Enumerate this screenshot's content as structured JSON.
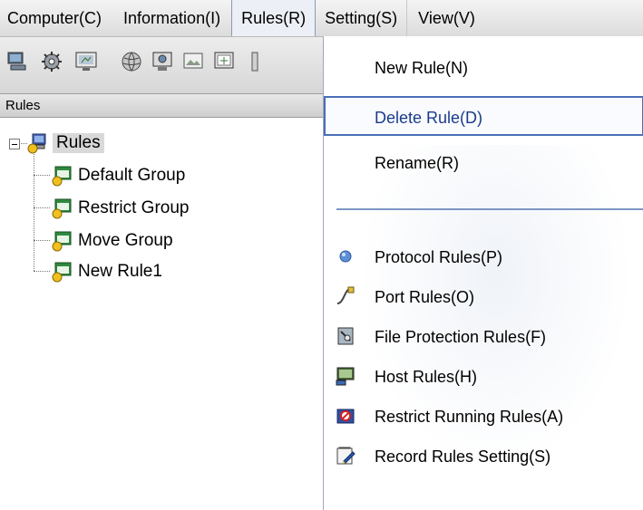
{
  "menubar": {
    "items": [
      {
        "label": "Computer(C)"
      },
      {
        "label": "Information(I)"
      },
      {
        "label": "Rules(R)"
      },
      {
        "label": "Setting(S)"
      },
      {
        "label": "View(V)"
      }
    ]
  },
  "toolbar": {
    "icons": [
      "computer-icon",
      "gear-icon",
      "monitor-icon",
      "network-icon",
      "screen-capture-icon",
      "picture-icon",
      "display-icon"
    ]
  },
  "panel": {
    "header": "Rules"
  },
  "tree": {
    "root": "Rules",
    "children": [
      "Default Group",
      "Restrict Group",
      "Move Group",
      "New Rule1"
    ]
  },
  "rules_menu": {
    "items": [
      {
        "label": "New Rule(N)",
        "selected": false
      },
      {
        "label": "Delete Rule(D)",
        "selected": true
      },
      {
        "label": "Rename(R)",
        "selected": false
      }
    ],
    "rule_items": [
      {
        "label": "Protocol Rules(P)",
        "icon": "protocol-icon"
      },
      {
        "label": "Port Rules(O)",
        "icon": "port-icon"
      },
      {
        "label": "File Protection Rules(F)",
        "icon": "file-protection-icon"
      },
      {
        "label": "Host Rules(H)",
        "icon": "host-icon"
      },
      {
        "label": "Restrict Running Rules(A)",
        "icon": "restrict-running-icon"
      },
      {
        "label": "Record Rules Setting(S)",
        "icon": "record-setting-icon"
      }
    ]
  },
  "colors": {
    "selection_border": "#4a6fb8",
    "separator": "#7d96c4"
  }
}
